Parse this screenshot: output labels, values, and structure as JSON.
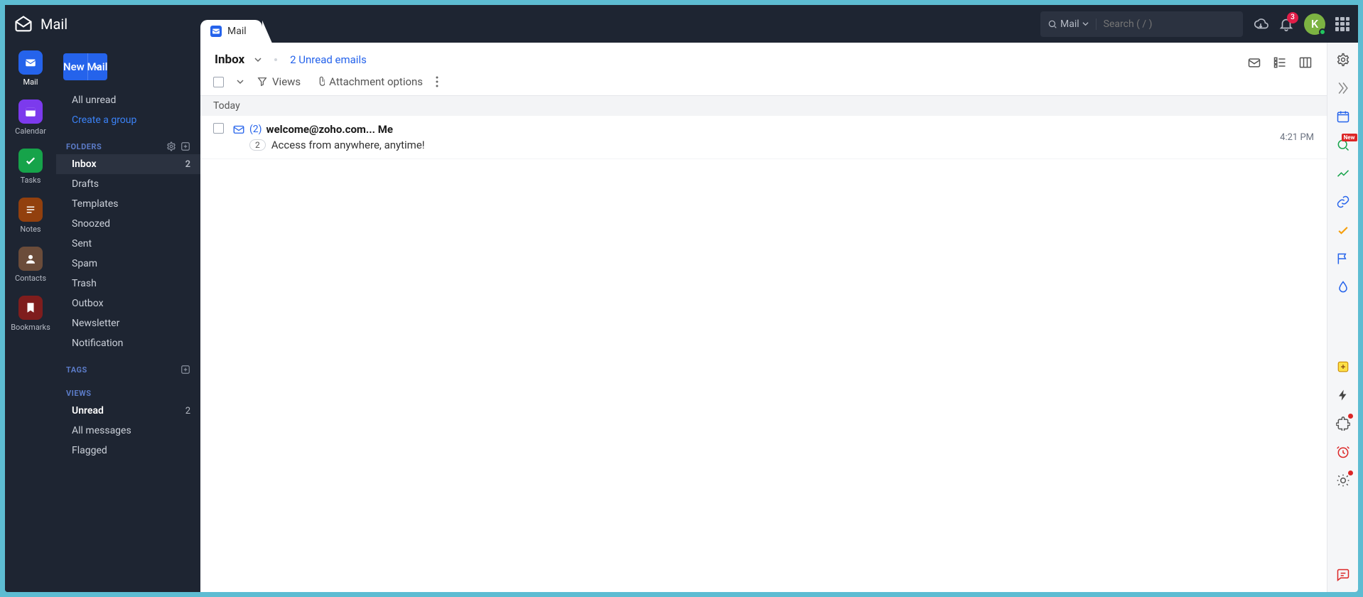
{
  "header": {
    "app_title": "Mail",
    "tab_label": "Mail",
    "search_scope": "Mail",
    "search_placeholder": "Search ( / )",
    "notification_count": "3",
    "avatar_initial": "K"
  },
  "nav_rail": [
    {
      "label": "Mail",
      "bg": "#2563EB",
      "active": true
    },
    {
      "label": "Calendar",
      "bg": "#7C3AED"
    },
    {
      "label": "Tasks",
      "bg": "#16A34A"
    },
    {
      "label": "Notes",
      "bg": "#92400E"
    },
    {
      "label": "Contacts",
      "bg": "#6B4C3A"
    },
    {
      "label": "Bookmarks",
      "bg": "#7F1D1D"
    }
  ],
  "sidebar": {
    "new_mail": "New Mail",
    "all_unread": "All unread",
    "create_group": "Create a group",
    "sections": {
      "folders": "FOLDERS",
      "tags": "TAGS",
      "views": "VIEWS"
    },
    "folders": [
      {
        "name": "Inbox",
        "count": "2",
        "active": true
      },
      {
        "name": "Drafts"
      },
      {
        "name": "Templates"
      },
      {
        "name": "Snoozed"
      },
      {
        "name": "Sent"
      },
      {
        "name": "Spam"
      },
      {
        "name": "Trash"
      },
      {
        "name": "Outbox"
      },
      {
        "name": "Newsletter"
      },
      {
        "name": "Notification"
      }
    ],
    "views": [
      {
        "name": "Unread",
        "count": "2",
        "bold": true
      },
      {
        "name": "All messages"
      },
      {
        "name": "Flagged"
      }
    ]
  },
  "content": {
    "folder_name": "Inbox",
    "unread_summary": "2 Unread emails",
    "toolbar": {
      "views": "Views",
      "attachments": "Attachment options"
    },
    "groups": [
      {
        "label": "Today",
        "messages": [
          {
            "thread_count": "(2)",
            "sender": "welcome@zoho.com... Me",
            "badge": "2",
            "subject": "Access from anywhere, anytime!",
            "time": "4:21 PM"
          }
        ]
      }
    ]
  },
  "right_rail": {
    "new_label": "New"
  }
}
